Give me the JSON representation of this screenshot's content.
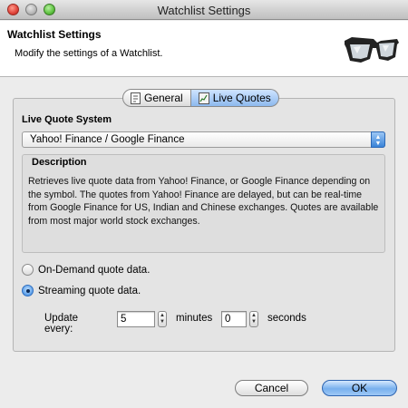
{
  "window": {
    "title": "Watchlist Settings"
  },
  "banner": {
    "title": "Watchlist Settings",
    "subtitle": "Modify the settings of a Watchlist."
  },
  "tabs": [
    {
      "label": "General",
      "icon": "document-icon",
      "selected": false
    },
    {
      "label": "Live Quotes",
      "icon": "quote-icon",
      "selected": true
    }
  ],
  "live_quotes": {
    "system_label": "Live Quote System",
    "system_value": "Yahoo! Finance / Google Finance",
    "description_label": "Description",
    "description_text": "Retrieves live quote data from Yahoo! Finance, or Google Finance depending on the symbol. The quotes from Yahoo! Finance are delayed, but can be real-time from Google Finance for US, Indian and Chinese exchanges. Quotes are available from most major world stock exchanges.",
    "on_demand_label": "On-Demand quote data.",
    "streaming_label": "Streaming quote data.",
    "selected_mode": "streaming",
    "update_every_label": "Update every:",
    "minutes_value": "5",
    "minutes_label": "minutes",
    "seconds_value": "0",
    "seconds_label": "seconds"
  },
  "buttons": {
    "cancel": "Cancel",
    "ok": "OK"
  },
  "colors": {
    "accent": "#3a84d8",
    "default_button": "#78b0ee"
  }
}
